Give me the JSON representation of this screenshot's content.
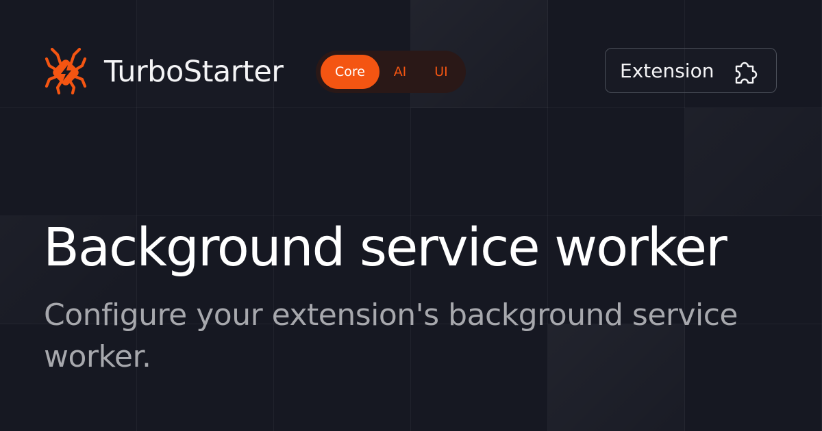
{
  "brand": {
    "name": "TurboStarter",
    "logo_icon": "spider-bolt-icon",
    "accent": "#F45512"
  },
  "tabs": [
    {
      "label": "Core",
      "active": true
    },
    {
      "label": "AI",
      "active": false
    },
    {
      "label": "UI",
      "active": false
    }
  ],
  "extension_button": {
    "label": "Extension",
    "icon": "puzzle-icon"
  },
  "content": {
    "title": "Background service worker",
    "subtitle": "Configure your extension's background service worker."
  },
  "colors": {
    "background": "#161822",
    "title": "#FFFFFF",
    "subtitle": "#A7A8AD",
    "tab_track": "#2A1817"
  }
}
